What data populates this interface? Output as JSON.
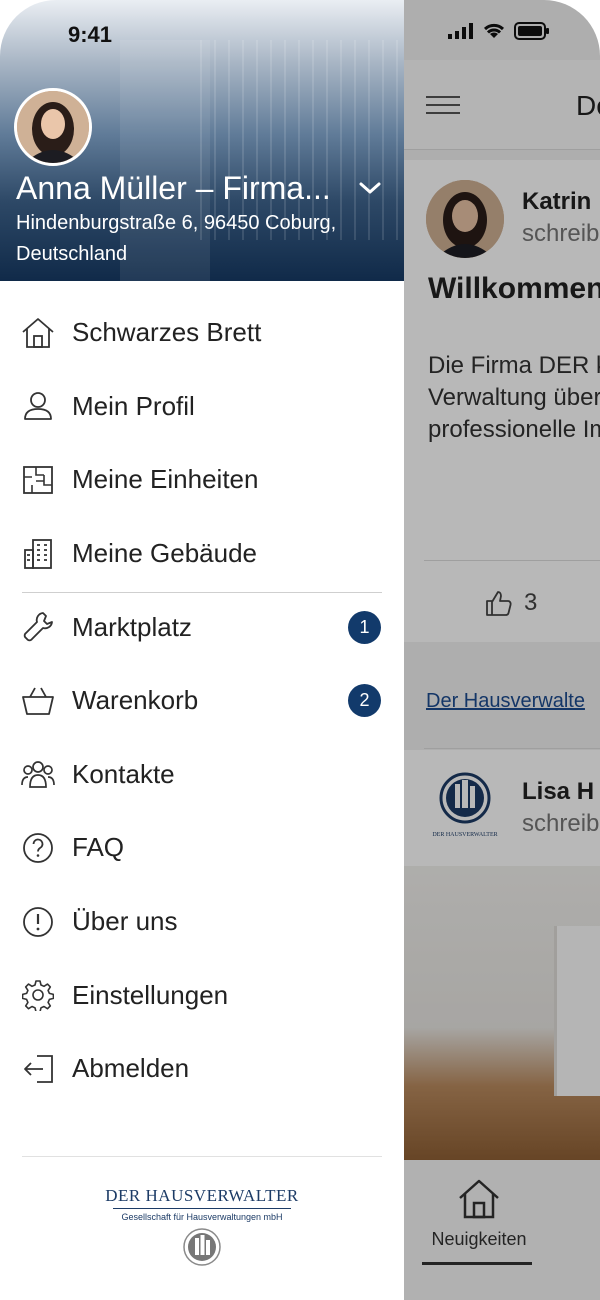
{
  "status_bar": {
    "time": "9:41"
  },
  "profile": {
    "name": "Anna Müller – Firma...",
    "address": "Hindenburgstraße 6, 96450 Coburg, Deutschland"
  },
  "menu": {
    "items": [
      {
        "label": "Schwarzes Brett",
        "icon": "home-icon",
        "badge": ""
      },
      {
        "label": "Mein Profil",
        "icon": "person-icon",
        "badge": ""
      },
      {
        "label": "Meine Einheiten",
        "icon": "floorplan-icon",
        "badge": ""
      },
      {
        "label": "Meine Gebäude",
        "icon": "building-icon",
        "badge": ""
      },
      {
        "label": "Marktplatz",
        "icon": "wrench-icon",
        "badge": "1"
      },
      {
        "label": "Warenkorb",
        "icon": "basket-icon",
        "badge": "2"
      },
      {
        "label": "Kontakte",
        "icon": "people-icon",
        "badge": ""
      },
      {
        "label": "FAQ",
        "icon": "question-icon",
        "badge": ""
      },
      {
        "label": "Über uns",
        "icon": "info-icon",
        "badge": ""
      },
      {
        "label": "Einstellungen",
        "icon": "gear-icon",
        "badge": ""
      },
      {
        "label": "Abmelden",
        "icon": "logout-icon",
        "badge": ""
      }
    ]
  },
  "footer": {
    "company_name": "DER HAUSVERWALTER",
    "company_subtitle": "Gesellschaft für Hausverwaltungen mbH"
  },
  "background_app": {
    "topbar_title": "De",
    "post1": {
      "author": "Katrin",
      "author_sub": "schreib",
      "title": "Willkommen App der Der",
      "body": "Die Firma DER konzentriert si die Verwaltung übernimmt übe professionelle Immobilien.",
      "likes": "3"
    },
    "link_text": "Der Hausverwalte",
    "post2": {
      "author": "Lisa H",
      "author_sub": "schreib",
      "logo_text": "DER HAUSVERWALTER"
    },
    "tab_label": "Neuigkeiten"
  },
  "colors": {
    "accent": "#123a6b",
    "header_dark": "#102a49"
  }
}
